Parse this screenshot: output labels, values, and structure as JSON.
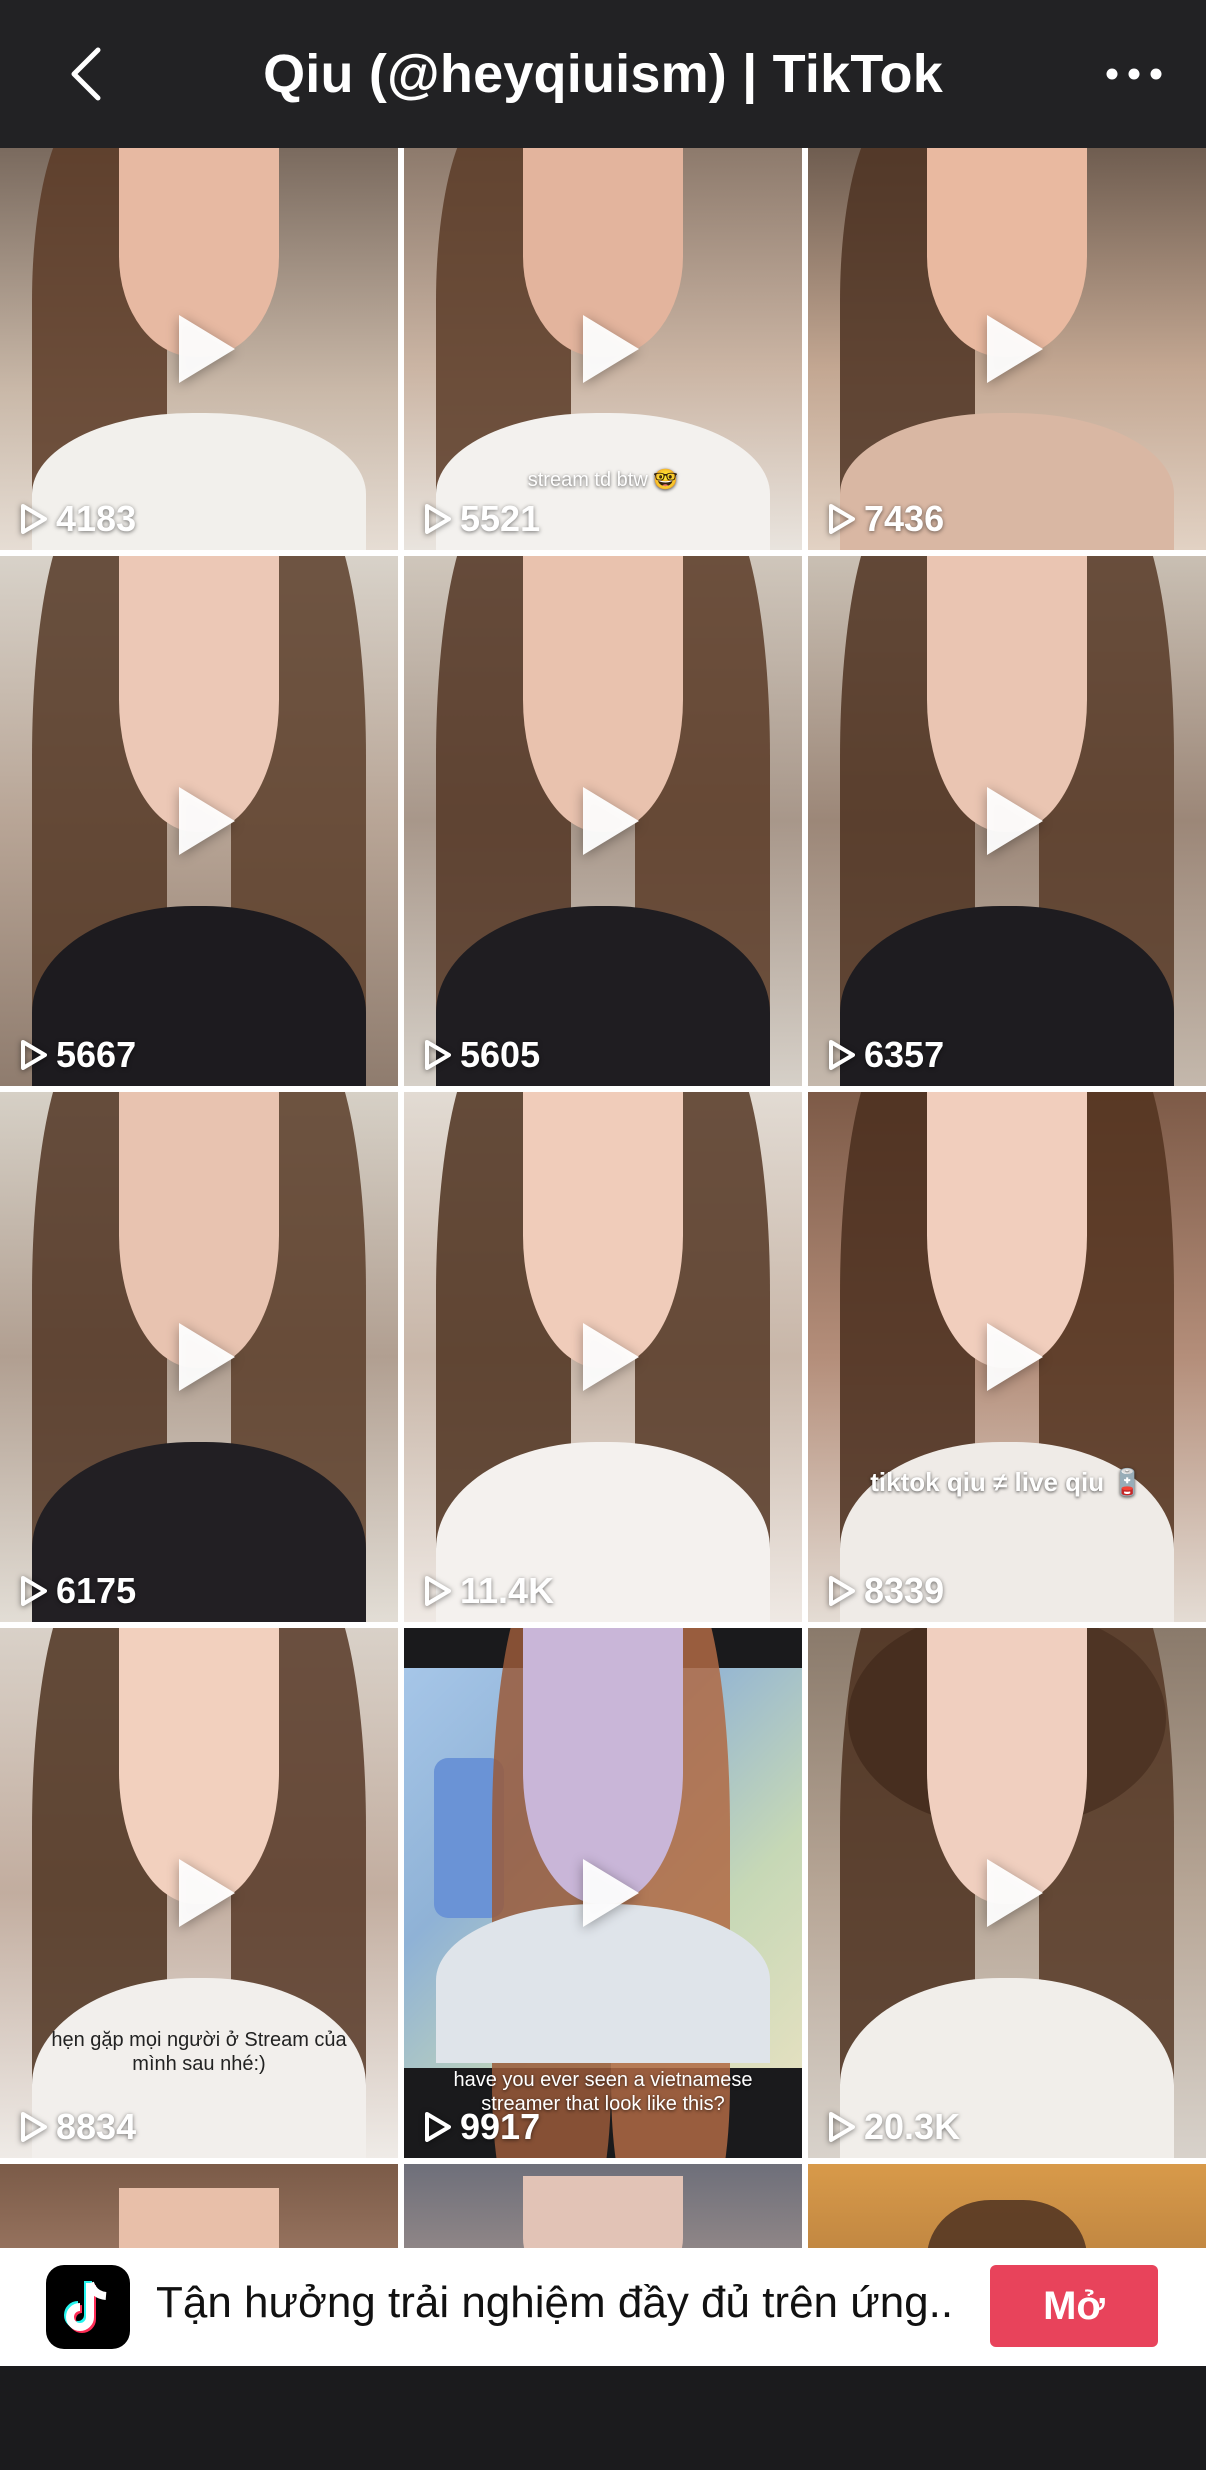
{
  "header": {
    "title": "Qiu (@heyqiuism) | TikTok",
    "back_icon": "chevron-left-icon",
    "more_icon": "more-horizontal-icon",
    "background": "#222224"
  },
  "videos": [
    {
      "views": "4183",
      "caption": ""
    },
    {
      "views": "5521",
      "caption": "stream td btw 🤓"
    },
    {
      "views": "7436",
      "caption": ""
    },
    {
      "views": "5667",
      "caption": ""
    },
    {
      "views": "5605",
      "caption": ""
    },
    {
      "views": "6357",
      "caption": ""
    },
    {
      "views": "6175",
      "caption": ""
    },
    {
      "views": "11.4K",
      "caption": ""
    },
    {
      "views": "8339",
      "caption": "tiktok qiu ≠ live qiu 🪫"
    },
    {
      "views": "8834",
      "caption": "hẹn gặp mọi người ở Stream của mình sau nhé:)"
    },
    {
      "views": "9917",
      "caption": "have you ever seen a vietnamese streamer that look like this?"
    },
    {
      "views": "20.3K",
      "caption": ""
    }
  ],
  "banner": {
    "text": "Tận hưởng trải nghiệm đầy đủ trên ứng...",
    "open_label": "Mở",
    "app_icon": "tiktok-logo-icon",
    "button_color": "#e8435b"
  }
}
